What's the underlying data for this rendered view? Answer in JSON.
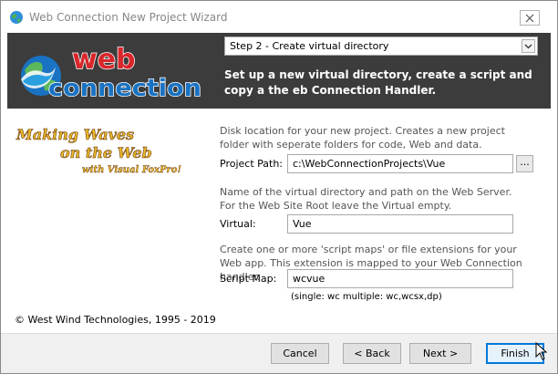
{
  "window": {
    "title": "Web Connection New Project Wizard",
    "close_icon": "close-icon"
  },
  "header": {
    "logo_top": "web",
    "logo_bottom": "connection",
    "step_select": {
      "value": "Step 2 - Create virtual directory"
    },
    "description": "Set up a new virtual directory, create a script and copy a the eb Connection Handler."
  },
  "side": {
    "tagline_line1": "Making Waves",
    "tagline_line2": "on the Web",
    "tagline_line3": "with Visual FoxPro!",
    "copyright": "© West Wind Technologies, 1995 - 2019"
  },
  "form": {
    "project_path": {
      "hint": "Disk location for your new project. Creates a new project folder with seperate folders for code, Web and data.",
      "label": "Project Path:",
      "value": "c:\\WebConnectionProjects\\Vue",
      "browse_label": "..."
    },
    "virtual": {
      "hint": "Name of the virtual directory and path on the Web Server. For the Web Site Root leave the Virtual empty.",
      "label": "Virtual:",
      "value": "Vue"
    },
    "script_map": {
      "hint": "Create one or more 'script maps' or file extensions for your Web app. This extension is mapped to your Web Connection handler.",
      "label": "Script Map:",
      "value": "wcvue",
      "note": "(single: wc  multiple: wc,wcsx,dp)"
    }
  },
  "buttons": {
    "cancel": "Cancel",
    "back": "< Back",
    "next": "Next >",
    "finish": "Finish"
  },
  "colors": {
    "header_bg": "#3c3c3c",
    "logo_red": "#d8262b",
    "logo_blue": "#1a73c2",
    "tagline_yellow": "#e9b82a",
    "focus_blue": "#0078d7"
  }
}
